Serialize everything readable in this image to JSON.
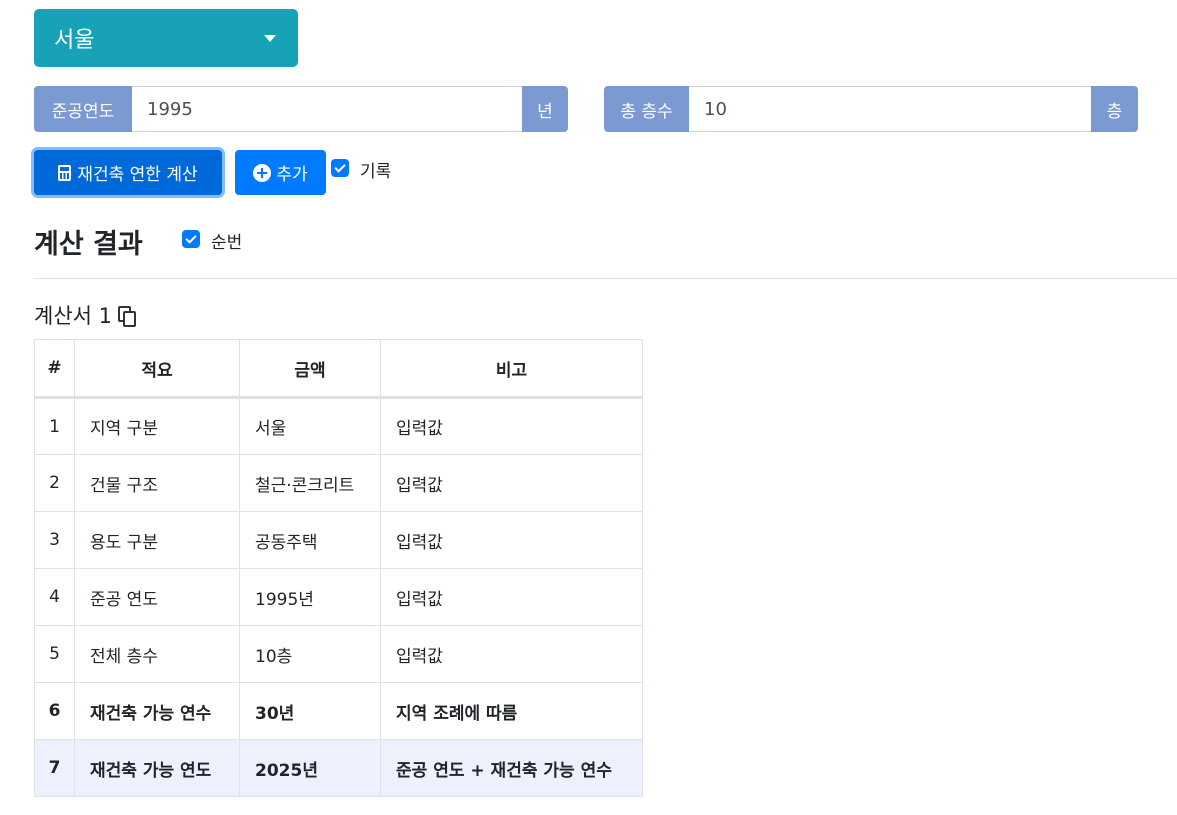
{
  "region_select": {
    "value": "서울"
  },
  "completion_year": {
    "label": "준공연도",
    "value": "1995",
    "unit": "년"
  },
  "total_floors": {
    "label": "총 층수",
    "value": "10",
    "unit": "층"
  },
  "buttons": {
    "calc_label": "재건축 연한 계산",
    "add_label": "추가"
  },
  "record_checkbox": {
    "label": "기록",
    "checked": true
  },
  "results": {
    "title": "계산 결과",
    "order_checkbox_label": "순번",
    "order_checked": true
  },
  "document": {
    "title": "계산서 1"
  },
  "table": {
    "headers": [
      "#",
      "적요",
      "금액",
      "비고"
    ],
    "rows": [
      [
        "1",
        "지역 구분",
        "서울",
        "입력값"
      ],
      [
        "2",
        "건물 구조",
        "철근·콘크리트",
        "입력값"
      ],
      [
        "3",
        "용도 구분",
        "공동주택",
        "입력값"
      ],
      [
        "4",
        "준공 연도",
        "1995년",
        "입력값"
      ],
      [
        "5",
        "전체 층수",
        "10층",
        "입력값"
      ],
      [
        "6",
        "재건축 가능 연수",
        "30년",
        "지역 조례에 따름"
      ],
      [
        "7",
        "재건축 가능 연도",
        "2025년",
        "준공 연도 + 재건축 가능 연수"
      ]
    ]
  },
  "colors": {
    "accent": "#007bff",
    "teal": "#17a2b8",
    "label_bg": "#7b9ad1",
    "highlight_row": "#eef0fd"
  }
}
